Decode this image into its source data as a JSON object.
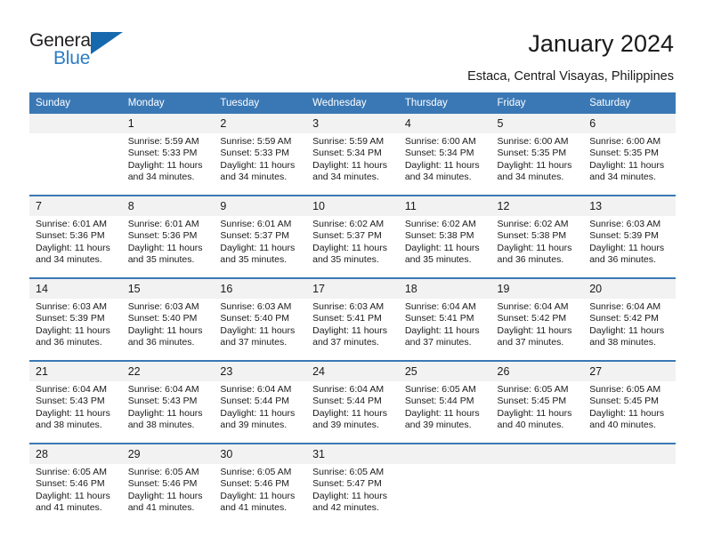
{
  "brand": {
    "name_top": "General",
    "name_bottom": "Blue",
    "accent_color": "#2b7cc4",
    "triangle_color": "#1769ad"
  },
  "header": {
    "title": "January 2024",
    "location": "Estaca, Central Visayas, Philippines"
  },
  "theme": {
    "header_bg": "#3a78b5",
    "header_text": "#ffffff",
    "daynum_bg": "#f2f2f2",
    "cell_bg": "#ffffff",
    "separator": "#3a78b5"
  },
  "weekday_headers": [
    "Sunday",
    "Monday",
    "Tuesday",
    "Wednesday",
    "Thursday",
    "Friday",
    "Saturday"
  ],
  "weeks": [
    {
      "days": [
        {
          "num": "",
          "sunrise": "",
          "sunset": "",
          "daylight1": "",
          "daylight2": ""
        },
        {
          "num": "1",
          "sunrise": "Sunrise: 5:59 AM",
          "sunset": "Sunset: 5:33 PM",
          "daylight1": "Daylight: 11 hours",
          "daylight2": "and 34 minutes."
        },
        {
          "num": "2",
          "sunrise": "Sunrise: 5:59 AM",
          "sunset": "Sunset: 5:33 PM",
          "daylight1": "Daylight: 11 hours",
          "daylight2": "and 34 minutes."
        },
        {
          "num": "3",
          "sunrise": "Sunrise: 5:59 AM",
          "sunset": "Sunset: 5:34 PM",
          "daylight1": "Daylight: 11 hours",
          "daylight2": "and 34 minutes."
        },
        {
          "num": "4",
          "sunrise": "Sunrise: 6:00 AM",
          "sunset": "Sunset: 5:34 PM",
          "daylight1": "Daylight: 11 hours",
          "daylight2": "and 34 minutes."
        },
        {
          "num": "5",
          "sunrise": "Sunrise: 6:00 AM",
          "sunset": "Sunset: 5:35 PM",
          "daylight1": "Daylight: 11 hours",
          "daylight2": "and 34 minutes."
        },
        {
          "num": "6",
          "sunrise": "Sunrise: 6:00 AM",
          "sunset": "Sunset: 5:35 PM",
          "daylight1": "Daylight: 11 hours",
          "daylight2": "and 34 minutes."
        }
      ]
    },
    {
      "days": [
        {
          "num": "7",
          "sunrise": "Sunrise: 6:01 AM",
          "sunset": "Sunset: 5:36 PM",
          "daylight1": "Daylight: 11 hours",
          "daylight2": "and 34 minutes."
        },
        {
          "num": "8",
          "sunrise": "Sunrise: 6:01 AM",
          "sunset": "Sunset: 5:36 PM",
          "daylight1": "Daylight: 11 hours",
          "daylight2": "and 35 minutes."
        },
        {
          "num": "9",
          "sunrise": "Sunrise: 6:01 AM",
          "sunset": "Sunset: 5:37 PM",
          "daylight1": "Daylight: 11 hours",
          "daylight2": "and 35 minutes."
        },
        {
          "num": "10",
          "sunrise": "Sunrise: 6:02 AM",
          "sunset": "Sunset: 5:37 PM",
          "daylight1": "Daylight: 11 hours",
          "daylight2": "and 35 minutes."
        },
        {
          "num": "11",
          "sunrise": "Sunrise: 6:02 AM",
          "sunset": "Sunset: 5:38 PM",
          "daylight1": "Daylight: 11 hours",
          "daylight2": "and 35 minutes."
        },
        {
          "num": "12",
          "sunrise": "Sunrise: 6:02 AM",
          "sunset": "Sunset: 5:38 PM",
          "daylight1": "Daylight: 11 hours",
          "daylight2": "and 36 minutes."
        },
        {
          "num": "13",
          "sunrise": "Sunrise: 6:03 AM",
          "sunset": "Sunset: 5:39 PM",
          "daylight1": "Daylight: 11 hours",
          "daylight2": "and 36 minutes."
        }
      ]
    },
    {
      "days": [
        {
          "num": "14",
          "sunrise": "Sunrise: 6:03 AM",
          "sunset": "Sunset: 5:39 PM",
          "daylight1": "Daylight: 11 hours",
          "daylight2": "and 36 minutes."
        },
        {
          "num": "15",
          "sunrise": "Sunrise: 6:03 AM",
          "sunset": "Sunset: 5:40 PM",
          "daylight1": "Daylight: 11 hours",
          "daylight2": "and 36 minutes."
        },
        {
          "num": "16",
          "sunrise": "Sunrise: 6:03 AM",
          "sunset": "Sunset: 5:40 PM",
          "daylight1": "Daylight: 11 hours",
          "daylight2": "and 37 minutes."
        },
        {
          "num": "17",
          "sunrise": "Sunrise: 6:03 AM",
          "sunset": "Sunset: 5:41 PM",
          "daylight1": "Daylight: 11 hours",
          "daylight2": "and 37 minutes."
        },
        {
          "num": "18",
          "sunrise": "Sunrise: 6:04 AM",
          "sunset": "Sunset: 5:41 PM",
          "daylight1": "Daylight: 11 hours",
          "daylight2": "and 37 minutes."
        },
        {
          "num": "19",
          "sunrise": "Sunrise: 6:04 AM",
          "sunset": "Sunset: 5:42 PM",
          "daylight1": "Daylight: 11 hours",
          "daylight2": "and 37 minutes."
        },
        {
          "num": "20",
          "sunrise": "Sunrise: 6:04 AM",
          "sunset": "Sunset: 5:42 PM",
          "daylight1": "Daylight: 11 hours",
          "daylight2": "and 38 minutes."
        }
      ]
    },
    {
      "days": [
        {
          "num": "21",
          "sunrise": "Sunrise: 6:04 AM",
          "sunset": "Sunset: 5:43 PM",
          "daylight1": "Daylight: 11 hours",
          "daylight2": "and 38 minutes."
        },
        {
          "num": "22",
          "sunrise": "Sunrise: 6:04 AM",
          "sunset": "Sunset: 5:43 PM",
          "daylight1": "Daylight: 11 hours",
          "daylight2": "and 38 minutes."
        },
        {
          "num": "23",
          "sunrise": "Sunrise: 6:04 AM",
          "sunset": "Sunset: 5:44 PM",
          "daylight1": "Daylight: 11 hours",
          "daylight2": "and 39 minutes."
        },
        {
          "num": "24",
          "sunrise": "Sunrise: 6:04 AM",
          "sunset": "Sunset: 5:44 PM",
          "daylight1": "Daylight: 11 hours",
          "daylight2": "and 39 minutes."
        },
        {
          "num": "25",
          "sunrise": "Sunrise: 6:05 AM",
          "sunset": "Sunset: 5:44 PM",
          "daylight1": "Daylight: 11 hours",
          "daylight2": "and 39 minutes."
        },
        {
          "num": "26",
          "sunrise": "Sunrise: 6:05 AM",
          "sunset": "Sunset: 5:45 PM",
          "daylight1": "Daylight: 11 hours",
          "daylight2": "and 40 minutes."
        },
        {
          "num": "27",
          "sunrise": "Sunrise: 6:05 AM",
          "sunset": "Sunset: 5:45 PM",
          "daylight1": "Daylight: 11 hours",
          "daylight2": "and 40 minutes."
        }
      ]
    },
    {
      "days": [
        {
          "num": "28",
          "sunrise": "Sunrise: 6:05 AM",
          "sunset": "Sunset: 5:46 PM",
          "daylight1": "Daylight: 11 hours",
          "daylight2": "and 41 minutes."
        },
        {
          "num": "29",
          "sunrise": "Sunrise: 6:05 AM",
          "sunset": "Sunset: 5:46 PM",
          "daylight1": "Daylight: 11 hours",
          "daylight2": "and 41 minutes."
        },
        {
          "num": "30",
          "sunrise": "Sunrise: 6:05 AM",
          "sunset": "Sunset: 5:46 PM",
          "daylight1": "Daylight: 11 hours",
          "daylight2": "and 41 minutes."
        },
        {
          "num": "31",
          "sunrise": "Sunrise: 6:05 AM",
          "sunset": "Sunset: 5:47 PM",
          "daylight1": "Daylight: 11 hours",
          "daylight2": "and 42 minutes."
        },
        {
          "num": "",
          "sunrise": "",
          "sunset": "",
          "daylight1": "",
          "daylight2": ""
        },
        {
          "num": "",
          "sunrise": "",
          "sunset": "",
          "daylight1": "",
          "daylight2": ""
        },
        {
          "num": "",
          "sunrise": "",
          "sunset": "",
          "daylight1": "",
          "daylight2": ""
        }
      ]
    }
  ]
}
